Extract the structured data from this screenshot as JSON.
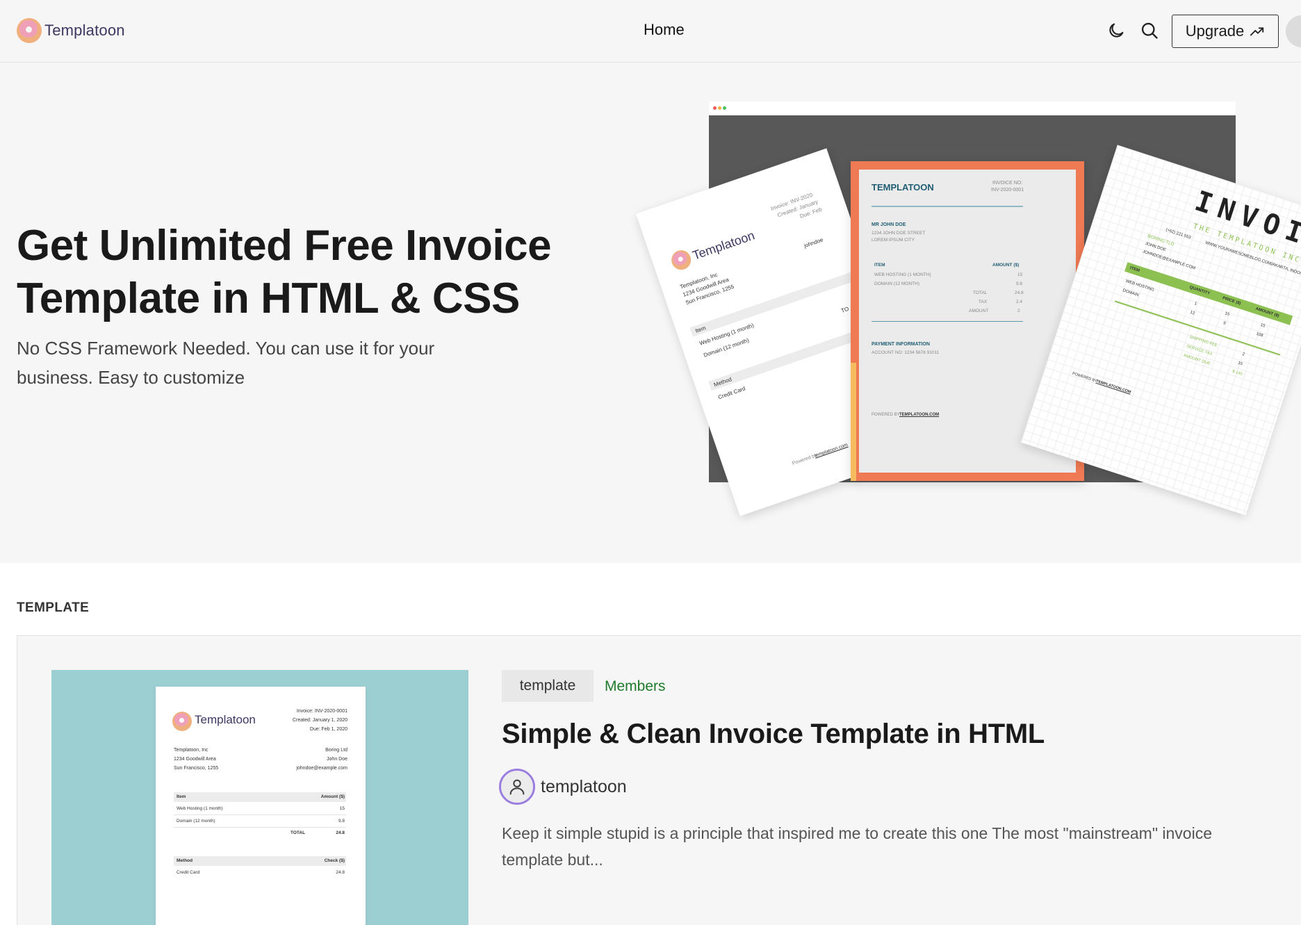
{
  "header": {
    "logo_text": "Templatoon",
    "nav_home": "Home",
    "upgrade_label": "Upgrade",
    "icons": [
      "moon-icon",
      "search-icon",
      "trending-up-icon",
      "avatar"
    ]
  },
  "hero": {
    "title": "Get Unlimited Free Invoice Template in HTML & CSS",
    "subtitle": "No CSS Framework Needed. You can use it for your business. Easy to customize",
    "art": {
      "doc1": {
        "brand": "Templatoon",
        "invoice": "Invoice: INV-2020",
        "created": "Created: January",
        "due": "Due: Feb",
        "from_1": "Templatoon, Inc",
        "from_2": "1234 Goodwill Area",
        "from_3": "Sun Francisco, 1255",
        "email": "johndoe",
        "item_header": "Item",
        "item_1": "Web Hosting (1 month)",
        "item_2": "Domain (12 month)",
        "total": "TO",
        "method_header": "Method",
        "method_1": "Credit Card",
        "powered": "Powered by",
        "powered_link": "templatoon.com"
      },
      "doc2": {
        "brand": "TEMPLATOON",
        "invoice_no_label": "INVOICE NO:",
        "invoice_no": "INV-2020-0001",
        "client": "MR JOHN DOE",
        "addr_1": "1234 JOHN DOE STREET",
        "addr_2": "LOREM IPSUM CITY",
        "item_header": "ITEM",
        "amount_header": "AMOUNT ($)",
        "item_1": "WEB HOSTING (1 MONTH)",
        "item_1_amount": "15",
        "item_2": "DOMAIN (12 MONTH)",
        "item_2_amount": "9.8",
        "total_label": "TOTAL",
        "total": "24.8",
        "tax_label": "TAX",
        "tax": "2.4",
        "amount_label": "AMOUNT",
        "amount": "2",
        "payment_header": "PAYMENT INFORMATION",
        "account": "ACCOUNT NO: 1234 5678 91011",
        "powered": "POWERED BY",
        "powered_link": "TEMPLATOON.COM"
      },
      "doc3": {
        "title": "INVOICE",
        "company": "THE TEMPLATOON INC",
        "phone": "(+62) 221 553",
        "web": "WWW.YOURAWESOMEBLOG.COM",
        "city": "JAKARTA, INDONESIA",
        "client_1": "BORING TLD",
        "client_2": "JOHN DOE",
        "client_3": "JOHNDOE@EXAMPLE.COM",
        "col_item": "ITEM",
        "col_qty": "QUANTITY",
        "col_price": "PRICE ($)",
        "col_amount": "AMOUNT ($)",
        "row_1": "WEB HOSTING",
        "row_1_qty": "1",
        "row_1_price": "15",
        "row_1_amount": "15",
        "row_2": "DOMAIN",
        "row_2_qty": "12",
        "row_2_price": "9",
        "row_2_amount": "108",
        "shipping": "SHIPPING FEE",
        "shipping_val": "2",
        "service": "SERVICE TAX",
        "service_val": "15",
        "due": "AMOUNT DUE",
        "due_val": "$ 145",
        "powered": "POWERED BY",
        "powered_link": "TEMPLATOON.COM"
      }
    }
  },
  "template_section": {
    "label": "TEMPLATE",
    "card": {
      "tag": "template",
      "members": "Members",
      "title": "Simple & Clean Invoice Template in HTML",
      "author": "templatoon",
      "excerpt": "Keep it simple stupid is a principle that inspired me to create this one The most \"mainstream\" invoice template but...",
      "thumb": {
        "brand": "Templatoon",
        "invoice": "Invoice: INV-2020-0001",
        "created": "Created: January 1, 2020",
        "due": "Due: Feb 1, 2020",
        "from_1": "Templatoon, Inc",
        "from_2": "1234 Goodwill Area",
        "from_3": "Sun Francisco, 1255",
        "to_1": "Boring Ltd",
        "to_2": "John Doe",
        "to_3": "johndoe@example.com",
        "item_header": "Item",
        "amount_header": "Amount ($)",
        "item_1": "Web Hosting (1 month)",
        "item_1_amount": "15",
        "item_2": "Domain (12 month)",
        "item_2_amount": "9.8",
        "total_label": "TOTAL",
        "total": "24.8",
        "method_header": "Method",
        "check_header": "Check ($)",
        "method_1": "Credit Card",
        "method_1_amount": "24.8"
      }
    }
  },
  "colors": {
    "background": "#f6f6f6",
    "nav_highlight": "#74e9c3",
    "members_green": "#1f7a2c",
    "thumb_bg": "#9ccfd2",
    "invoice_orange": "#f07a54",
    "invoice_teal": "#1f5e73",
    "invoice_green": "#8cc152",
    "avatar_ring": "#9a7ee0"
  }
}
